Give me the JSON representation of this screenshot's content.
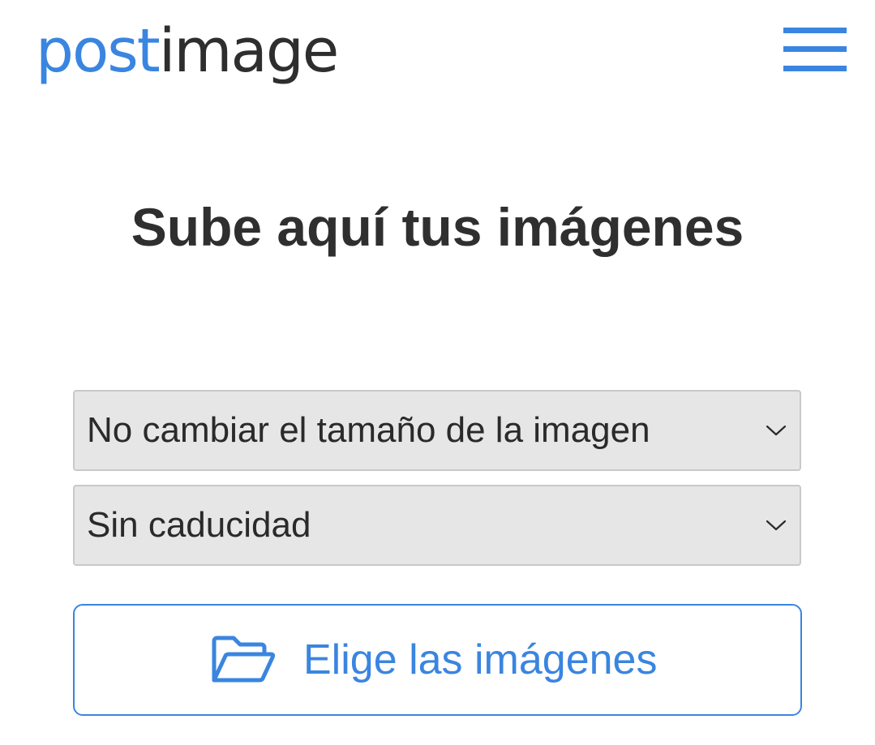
{
  "header": {
    "logo": {
      "part1": "post",
      "part2": "image"
    },
    "menu_icon": "hamburger-menu-icon"
  },
  "main": {
    "title": "Sube aquí tus imágenes",
    "resize_select": {
      "value": "No cambiar el tamaño de la imagen",
      "icon": "chevron-down-icon"
    },
    "expiry_select": {
      "value": "Sin caducidad",
      "icon": "chevron-down-icon"
    },
    "choose_button": {
      "label": "Elige las imágenes",
      "icon": "folder-open-icon"
    }
  },
  "colors": {
    "accent": "#3a85e0",
    "text": "#2f2f2f",
    "select_bg": "#e6e6e6",
    "select_border": "#c9c9c9"
  }
}
